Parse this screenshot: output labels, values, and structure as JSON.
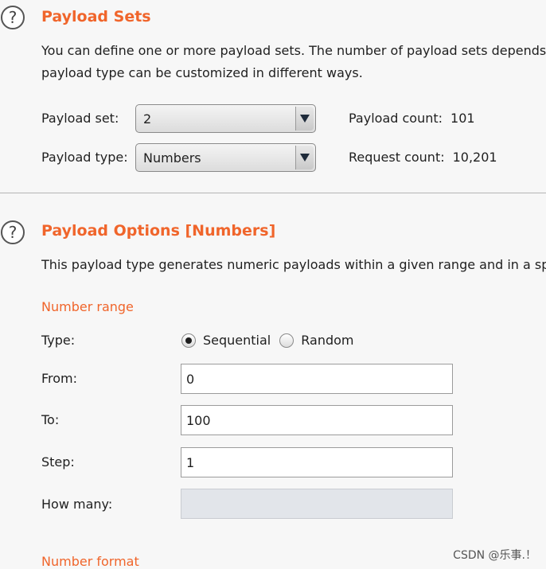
{
  "payload_sets": {
    "title": "Payload Sets",
    "description_line1": "You can define one or more payload sets. The number of payload sets depends",
    "description_line2": "payload type can be customized in different ways.",
    "set_label": "Payload set:",
    "set_value": "2",
    "type_label": "Payload type:",
    "type_value": "Numbers",
    "payload_count_label": "Payload count:",
    "payload_count_value": "101",
    "request_count_label": "Request count:",
    "request_count_value": "10,201"
  },
  "payload_options": {
    "title": "Payload Options [Numbers]",
    "description": "This payload type generates numeric payloads within a given range and in a specified",
    "number_range_heading": "Number range",
    "type_label": "Type:",
    "sequential_label": "Sequential",
    "random_label": "Random",
    "selected_type": "Sequential",
    "from_label": "From:",
    "from_value": "0",
    "to_label": "To:",
    "to_value": "100",
    "step_label": "Step:",
    "step_value": "1",
    "how_many_label": "How many:",
    "how_many_value": "",
    "number_format_heading": "Number format"
  },
  "watermark": "CSDN @乐事.！",
  "icons": {
    "help": "?"
  },
  "colors": {
    "accent": "#f0652b",
    "background": "#f7f7f7"
  }
}
